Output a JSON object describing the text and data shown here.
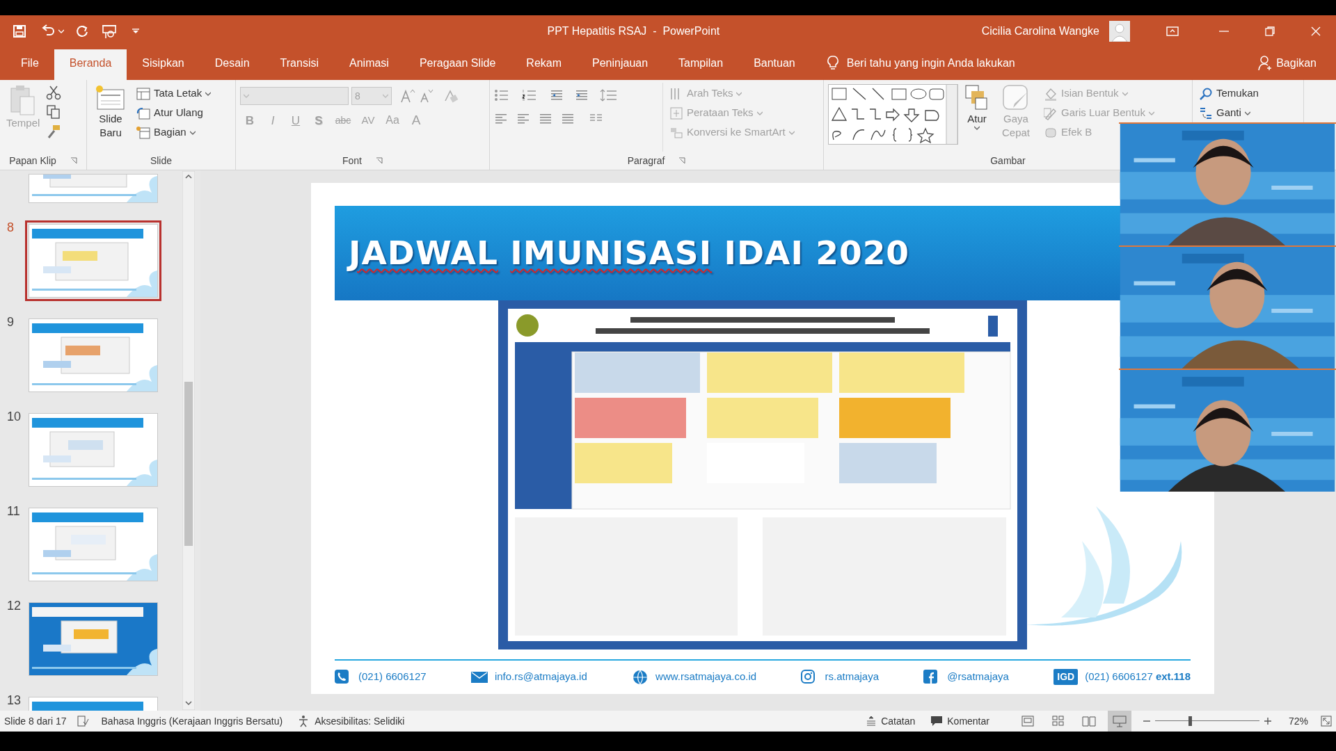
{
  "title_bar": {
    "document_title": "PPT Hepatitis RSAJ  -  PowerPoint",
    "user_name": "Cicilia Carolina Wangke"
  },
  "tabs": [
    {
      "label": "File",
      "selected": false
    },
    {
      "label": "Beranda",
      "selected": true
    },
    {
      "label": "Sisipkan",
      "selected": false
    },
    {
      "label": "Desain",
      "selected": false
    },
    {
      "label": "Transisi",
      "selected": false
    },
    {
      "label": "Animasi",
      "selected": false
    },
    {
      "label": "Peragaan Slide",
      "selected": false
    },
    {
      "label": "Rekam",
      "selected": false
    },
    {
      "label": "Peninjauan",
      "selected": false
    },
    {
      "label": "Tampilan",
      "selected": false
    },
    {
      "label": "Bantuan",
      "selected": false
    }
  ],
  "tell_me": "Beri tahu yang ingin Anda lakukan",
  "share": "Bagikan",
  "ribbon": {
    "clipboard": {
      "label": "Papan Klip",
      "paste": {
        "label": "Tempel",
        "disabled": true
      }
    },
    "slides": {
      "label": "Slide",
      "new_slide": {
        "label": "Slide Baru",
        "disabled": false
      },
      "layout": {
        "label": "Tata Letak",
        "disabled": false
      },
      "reset": {
        "label": "Atur Ulang",
        "disabled": false
      },
      "section": {
        "label": "Bagian",
        "disabled": false
      }
    },
    "font": {
      "label": "Font",
      "font_size": "8",
      "format_buttons": [
        {
          "label": "B",
          "disabled": true
        },
        {
          "label": "I",
          "disabled": true
        },
        {
          "label": "U",
          "disabled": true
        },
        {
          "label": "S",
          "disabled": true
        },
        {
          "label": "abc",
          "disabled": true
        },
        {
          "label": "AV",
          "disabled": true
        },
        {
          "label": "Aa",
          "disabled": true
        },
        {
          "label": "A",
          "disabled": true
        }
      ]
    },
    "paragraph": {
      "label": "Paragraf",
      "text_direction": {
        "label": "Arah Teks",
        "disabled": true
      },
      "align_text": {
        "label": "Perataan Teks",
        "disabled": true
      },
      "convert_smartart": {
        "label": "Konversi ke SmartArt",
        "disabled": true
      }
    },
    "drawing": {
      "label": "Gambar",
      "arrange": {
        "label": "Atur",
        "disabled": false
      },
      "quick_styles": {
        "label": "Gaya Cepat",
        "disabled": true
      },
      "shape_fill": {
        "label": "Isian Bentuk",
        "disabled": true
      },
      "shape_outline": {
        "label": "Garis Luar Bentuk",
        "disabled": true
      },
      "shape_effects": {
        "label": "Efek B",
        "disabled": true
      }
    },
    "editing": {
      "find": {
        "label": "Temukan",
        "disabled": false
      },
      "replace": {
        "label": "Ganti",
        "disabled": false
      }
    }
  },
  "thumbnails": [
    {
      "selected": false
    },
    {
      "number": "8",
      "selected": true
    },
    {
      "number": "9",
      "selected": false
    },
    {
      "number": "10",
      "selected": false
    },
    {
      "number": "11",
      "selected": false
    },
    {
      "number": "12",
      "selected": false
    },
    {
      "number": "13",
      "selected": false
    }
  ],
  "slide": {
    "title": [
      {
        "text": "JADWAL",
        "misspelled": true
      },
      {
        "text": "IMUNISASI",
        "misspelled": true
      },
      {
        "text": "IDAI",
        "misspelled": false
      },
      {
        "text": "2020",
        "misspelled": false
      }
    ],
    "contacts": [
      {
        "kind": "phone",
        "text": "(021) 6606127"
      },
      {
        "kind": "email",
        "text": "info.rs@atmajaya.id"
      },
      {
        "kind": "web",
        "text": "www.rsatmajaya.co.id"
      },
      {
        "kind": "instagram",
        "text": "rs.atmajaya"
      },
      {
        "kind": "facebook",
        "text": "@rsatmajaya"
      },
      {
        "kind": "emergency",
        "badge": "IGD",
        "text": "(021) 6606127 **ext.118**"
      }
    ]
  },
  "status_bar": {
    "slide_info": "Slide 8 dari 17",
    "language": "Bahasa Inggris (Kerajaan Inggris Bersatu)",
    "accessibility": "Aksesibilitas: Selidiki",
    "notes": "Catatan",
    "comments": "Komentar",
    "views": [
      {
        "selected": false
      },
      {
        "selected": false
      },
      {
        "selected": false
      },
      {
        "selected": true
      }
    ],
    "zoom": {
      "level": 0.33,
      "reading": "72%"
    }
  }
}
